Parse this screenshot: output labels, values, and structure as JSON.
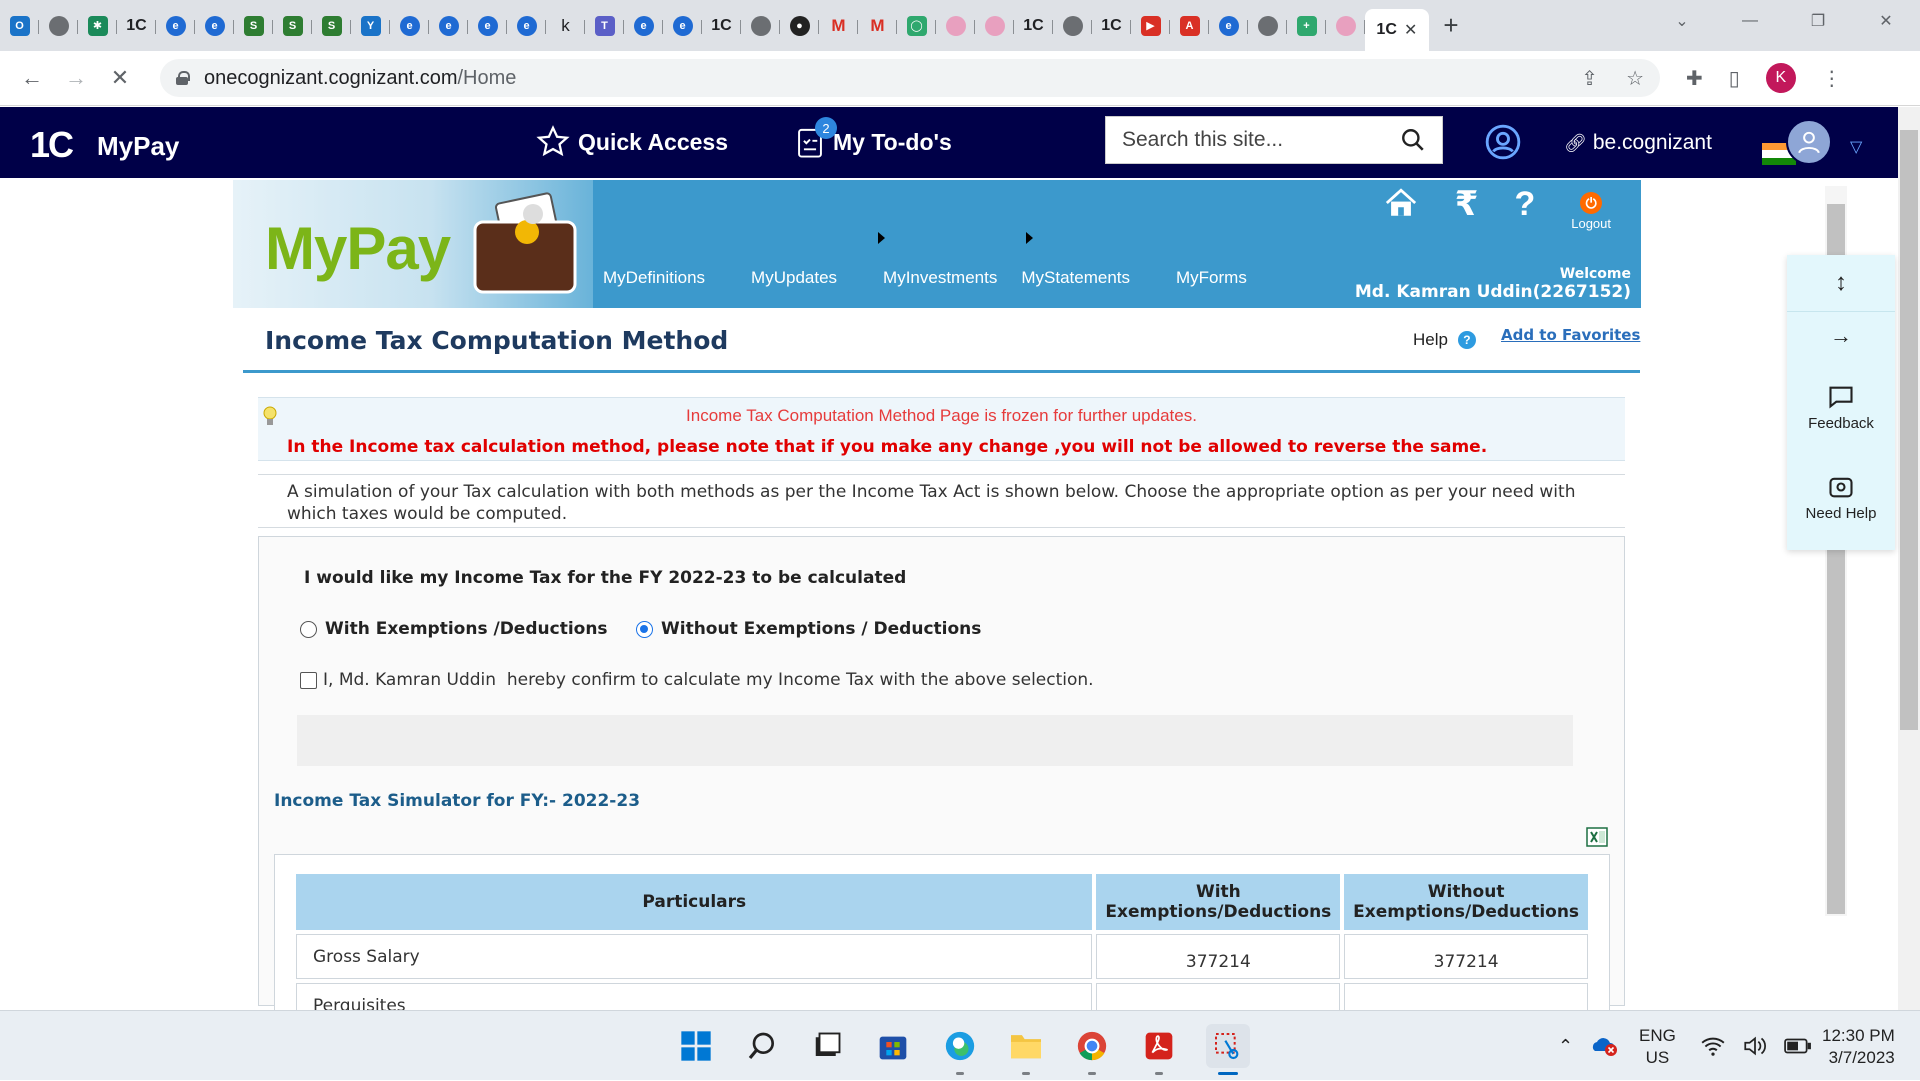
{
  "browser": {
    "active_tab_label": "1C",
    "url_host": "onecognizant.cognizant.com",
    "url_path": "/Home",
    "profile_initial": "K"
  },
  "sitenav": {
    "brand_logo": "1C",
    "brand_name": "MyPay",
    "quick_access": "Quick Access",
    "todo_label": "My To-do's",
    "todo_count": "2",
    "search_placeholder": "Search this site...",
    "be_cognizant": "be.cognizant"
  },
  "mypay_header": {
    "logo_text": "MyPay",
    "menu": [
      "MyDefinitions",
      "MyUpdates",
      "MyInvestments",
      "MyStatements",
      "MyForms"
    ],
    "logout": "Logout",
    "welcome": "Welcome",
    "user": "Md. Kamran Uddin(2267152)"
  },
  "page": {
    "title": "Income Tax Computation Method",
    "help": "Help",
    "add_favorites": "Add to Favorites",
    "notice_frozen": "Income Tax Computation Method Page is frozen for further updates.",
    "notice_warning": "In the Income tax calculation method, please note that if you make any change ,you will not be allowed to reverse the same.",
    "simulation_note": "A simulation of your Tax calculation with both methods as per the Income Tax Act is shown below. Choose the appropriate option as per your need with which taxes would be computed.",
    "question": "I would like my Income Tax for the FY 2022-23 to be calculated",
    "option_with": "With Exemptions /Deductions",
    "option_without": "Without Exemptions / Deductions",
    "selected_option": "without",
    "confirm_text": "I, Md. Kamran Uddin  hereby confirm to calculate my Income Tax with the above selection.",
    "simulator_title": "Income Tax Simulator for FY:- 2022-23"
  },
  "table": {
    "headers": [
      "Particulars",
      "With Exemptions/Deductions",
      "Without Exemptions/Deductions"
    ],
    "header_with_1": "With",
    "header_with_2": "Exemptions/Deductions",
    "header_without_1": "Without",
    "header_without_2": "Exemptions/Deductions",
    "rows": [
      {
        "label": "Gross Salary",
        "with": "377214",
        "without": "377214"
      },
      {
        "label": "Perquisites",
        "with": "",
        "without": ""
      }
    ]
  },
  "float_panel": {
    "feedback": "Feedback",
    "need_help": "Need Help"
  },
  "taskbar": {
    "lang_1": "ENG",
    "lang_2": "US",
    "time": "12:30 PM",
    "date": "3/7/2023"
  },
  "colors": {
    "site_nav_bg": "#000048",
    "mypay_header_bg": "#3c99cc",
    "table_header_bg": "#aad4ee",
    "warning_red": "#e00000",
    "float_panel_bg": "#e3f7fc"
  }
}
